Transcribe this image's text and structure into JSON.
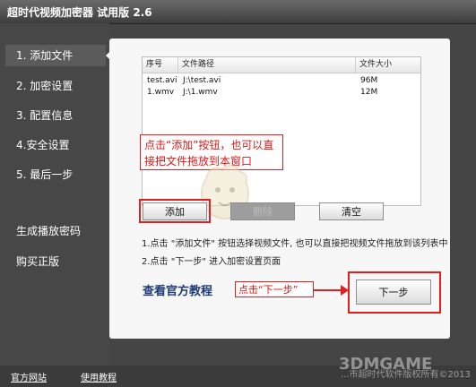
{
  "window": {
    "title": "超时代视频加密器 试用版 2.6"
  },
  "sidebar": {
    "items": [
      {
        "label": "1. 添加文件",
        "active": true
      },
      {
        "label": "2. 加密设置",
        "active": false
      },
      {
        "label": "3. 配置信息",
        "active": false
      },
      {
        "label": "4.安全设置",
        "active": false
      },
      {
        "label": "5. 最后一步",
        "active": false
      }
    ],
    "extra": [
      {
        "label": "生成播放密码"
      },
      {
        "label": "购买正版"
      }
    ]
  },
  "file_table": {
    "columns": [
      "序号",
      "文件路径",
      "文件大小"
    ],
    "rows": [
      [
        "test.avi",
        "J:\\test.avi",
        "96M"
      ],
      [
        "1.wmv",
        "J:\\1.wmv",
        "12M"
      ]
    ]
  },
  "callouts": {
    "drag_tip": "点击“添加”按钮，也可以直接把文件拖放到本窗口",
    "next_tip": "点击“下一步”"
  },
  "buttons": {
    "add": "添加",
    "delete": "删除",
    "clear": "清空",
    "next": "下一步"
  },
  "hints": [
    "1.点击 \"添加文件\" 按钮选择视频文件, 也可以直接把视频文件拖放到该列表中",
    "2.点击 \"下一步\" 进入加密设置页面"
  ],
  "links": {
    "tutorial": "查看官方教程"
  },
  "footer": {
    "official_site": "官方网站",
    "tutorial": "使用教程",
    "watermark": "...市超时代软件版权所有©2013"
  },
  "logos": {
    "site_logo": "3DMGAME"
  },
  "colors": {
    "accent_red": "#e02020",
    "panel_bg": "#f7f7f7",
    "sidebar_bg": "#474747"
  }
}
